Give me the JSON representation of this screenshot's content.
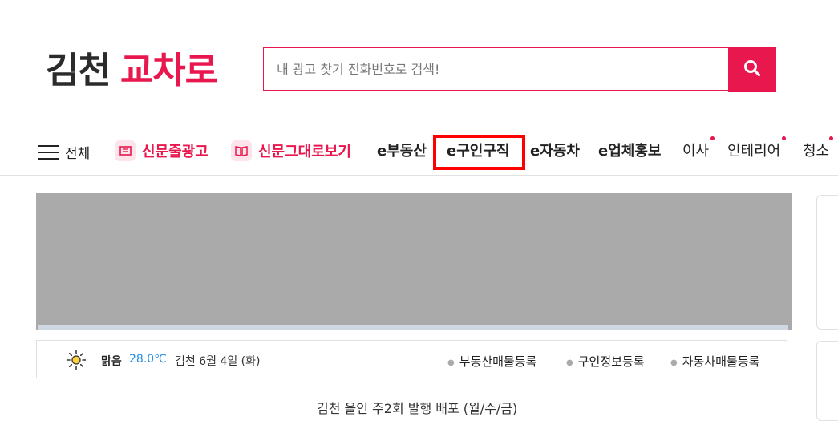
{
  "logo": {
    "part1": "김천",
    "part2": "교차로"
  },
  "search": {
    "placeholder": "내 광고 찾기 전화번호로 검색!"
  },
  "nav": {
    "menu_label": "전체",
    "items": [
      {
        "label": "신문줄광고"
      },
      {
        "label": "신문그대로보기"
      },
      {
        "label": "e부동산"
      },
      {
        "label": "e구인구직"
      },
      {
        "label": "e자동차"
      },
      {
        "label": "e업체홍보"
      },
      {
        "label": "이사"
      },
      {
        "label": "인테리어"
      },
      {
        "label": "청소"
      }
    ]
  },
  "weather": {
    "condition": "맑음",
    "temperature": "28.0℃",
    "location_date": "김천 6월 4일 (화)"
  },
  "quick_links": [
    {
      "label": "부동산매물등록"
    },
    {
      "label": "구인정보등록"
    },
    {
      "label": "자동차매물등록"
    }
  ],
  "colors": {
    "brand": "#e8174d",
    "temp": "#2a8fe3",
    "highlight": "#ff0000",
    "banner": "#aaaaaa"
  },
  "bottom": {
    "news": "김천 올인 주2회 발행 배포 (월/수/금)"
  }
}
